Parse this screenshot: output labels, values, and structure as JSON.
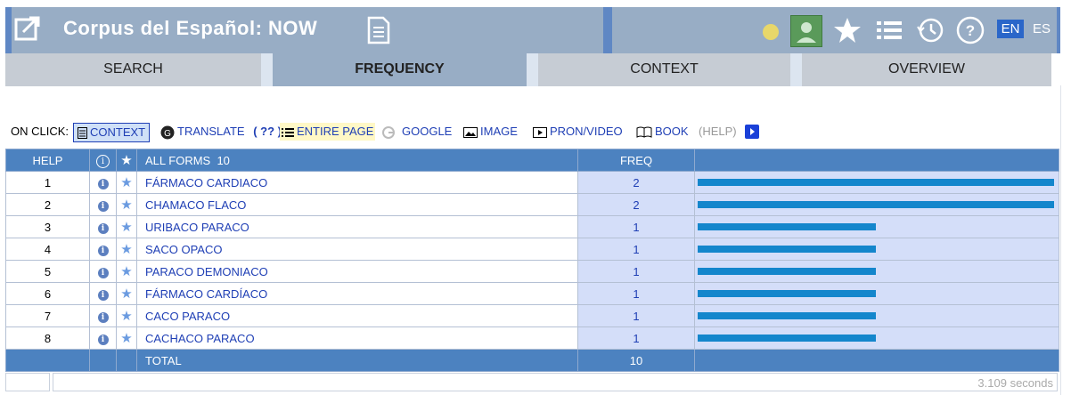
{
  "header": {
    "title": "Corpus del Español: NOW",
    "lang_en": "EN",
    "lang_es": "ES",
    "colors": {
      "header_bg": "#98adc5",
      "accent": "#5f87c4",
      "lang_active": "#2a66c9"
    }
  },
  "tabs": [
    {
      "label": "SEARCH"
    },
    {
      "label": "FREQUENCY",
      "active": true
    },
    {
      "label": "CONTEXT"
    },
    {
      "label": "OVERVIEW"
    }
  ],
  "onclick": {
    "label": "ON CLICK:",
    "items": {
      "context": "CONTEXT",
      "translate": "TRANSLATE",
      "translate_q": "( ?? )",
      "entire_page": "ENTIRE PAGE",
      "google": "GOOGLE",
      "image": "IMAGE",
      "pron_video": "PRON/VIDEO",
      "book": "BOOK",
      "help": "(HELP)"
    }
  },
  "table": {
    "headers": {
      "help": "HELP",
      "all_forms": "ALL FORMS",
      "count": "10",
      "freq": "FREQ"
    },
    "rows": [
      {
        "n": "1",
        "word": "FÁRMACO CARDIACO",
        "freq": "2",
        "bar": 1.0
      },
      {
        "n": "2",
        "word": "CHAMACO FLACO",
        "freq": "2",
        "bar": 1.0
      },
      {
        "n": "3",
        "word": "URIBACO PARACO",
        "freq": "1",
        "bar": 0.5
      },
      {
        "n": "4",
        "word": "SACO OPACO",
        "freq": "1",
        "bar": 0.5
      },
      {
        "n": "5",
        "word": "PARACO DEMONIACO",
        "freq": "1",
        "bar": 0.5
      },
      {
        "n": "6",
        "word": "FÁRMACO CARDÍACO",
        "freq": "1",
        "bar": 0.5
      },
      {
        "n": "7",
        "word": "CACO PARACO",
        "freq": "1",
        "bar": 0.5
      },
      {
        "n": "8",
        "word": "CACHACO PARACO",
        "freq": "1",
        "bar": 0.5
      }
    ],
    "total_label": "TOTAL",
    "total_value": "10"
  },
  "footer": {
    "timing": "3.109 seconds"
  },
  "icons": [
    "app-share-icon",
    "document-icon",
    "user-icon",
    "star-icon",
    "list-icon",
    "history-icon",
    "help-icon",
    "info-icon",
    "translate-icon",
    "google-icon",
    "image-icon",
    "video-icon",
    "book-icon",
    "play-icon"
  ]
}
